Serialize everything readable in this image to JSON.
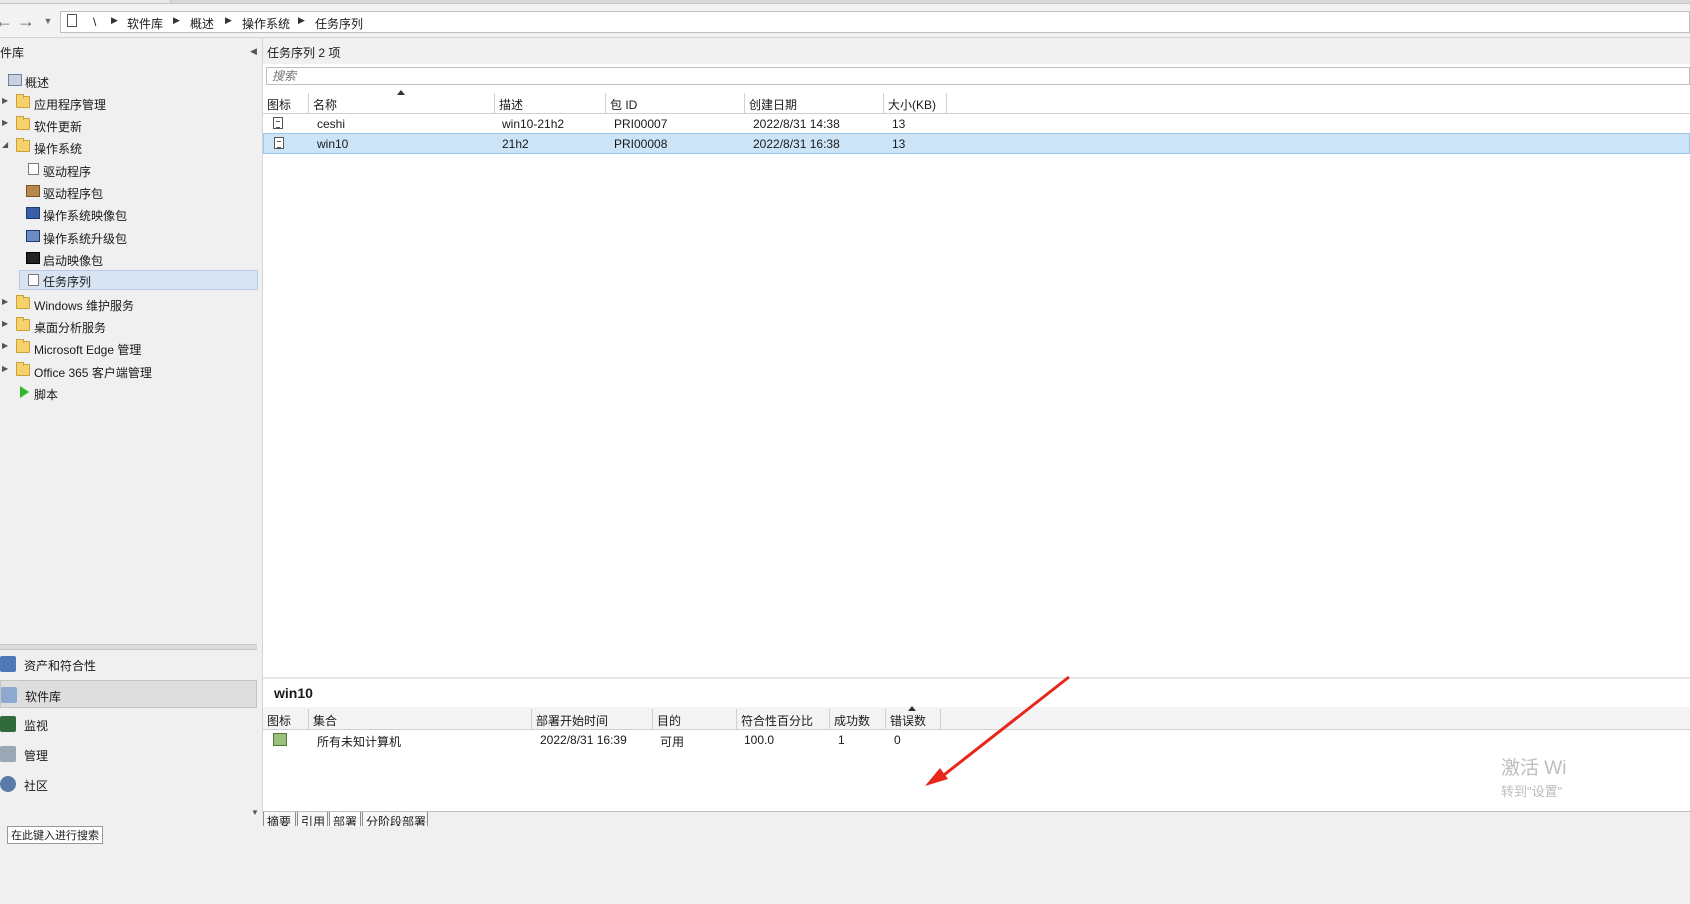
{
  "breadcrumb": {
    "root": "\\",
    "items": [
      "软件库",
      "概述",
      "操作系统",
      "任务序列"
    ]
  },
  "left": {
    "title": "件库",
    "tree": [
      {
        "label": "概述",
        "icon": "overview-icon"
      },
      {
        "label": "应用程序管理",
        "icon": "folder-icon"
      },
      {
        "label": "软件更新",
        "icon": "folder-icon"
      },
      {
        "label": "操作系统",
        "icon": "folder-icon"
      },
      {
        "label": "驱动程序",
        "icon": "driver-icon"
      },
      {
        "label": "驱动程序包",
        "icon": "driver-package-icon"
      },
      {
        "label": "操作系统映像包",
        "icon": "os-image-icon"
      },
      {
        "label": "操作系统升级包",
        "icon": "os-upgrade-icon"
      },
      {
        "label": "启动映像包",
        "icon": "boot-image-icon"
      },
      {
        "label": "任务序列",
        "icon": "task-sequence-icon"
      },
      {
        "label": "Windows 维护服务",
        "icon": "folder-icon"
      },
      {
        "label": "桌面分析服务",
        "icon": "folder-icon"
      },
      {
        "label": "Microsoft Edge 管理",
        "icon": "folder-icon"
      },
      {
        "label": "Office 365 客户端管理",
        "icon": "folder-icon"
      },
      {
        "label": "脚本",
        "icon": "play-icon"
      }
    ],
    "workspaces": [
      {
        "label": "资产和符合性",
        "icon": "assets-icon"
      },
      {
        "label": "软件库",
        "icon": "software-library-icon"
      },
      {
        "label": "监视",
        "icon": "monitoring-icon"
      },
      {
        "label": "管理",
        "icon": "administration-icon"
      },
      {
        "label": "社区",
        "icon": "community-icon"
      }
    ]
  },
  "main": {
    "title": "任务序列 2 项",
    "search_placeholder": "搜索",
    "columns": [
      "图标",
      "名称",
      "描述",
      "包 ID",
      "创建日期",
      "大小(KB)"
    ],
    "rows": [
      {
        "name": "ceshi",
        "desc": "win10-21h2",
        "pkg": "PRI00007",
        "date": "2022/8/31 14:38",
        "size": "13"
      },
      {
        "name": "win10",
        "desc": "21h2",
        "pkg": "PRI00008",
        "date": "2022/8/31 16:38",
        "size": "13"
      }
    ]
  },
  "detail": {
    "title": "win10",
    "columns": [
      "图标",
      "集合",
      "部署开始时间",
      "目的",
      "符合性百分比",
      "成功数",
      "错误数"
    ],
    "rows": [
      {
        "collection": "所有未知计算机",
        "start": "2022/8/31 16:39",
        "purpose": "可用",
        "compliance": "100.0",
        "success": "1",
        "errors": "0"
      }
    ],
    "watermark_line1": "激活 Wi",
    "watermark_line2": "转到\"设置\""
  },
  "tabs": [
    "摘要",
    "引用",
    "部署",
    "分阶段部署"
  ],
  "status": "在此键入进行搜索",
  "colors": {
    "selection": "#cce4f7",
    "arrow": "#e8261b"
  }
}
